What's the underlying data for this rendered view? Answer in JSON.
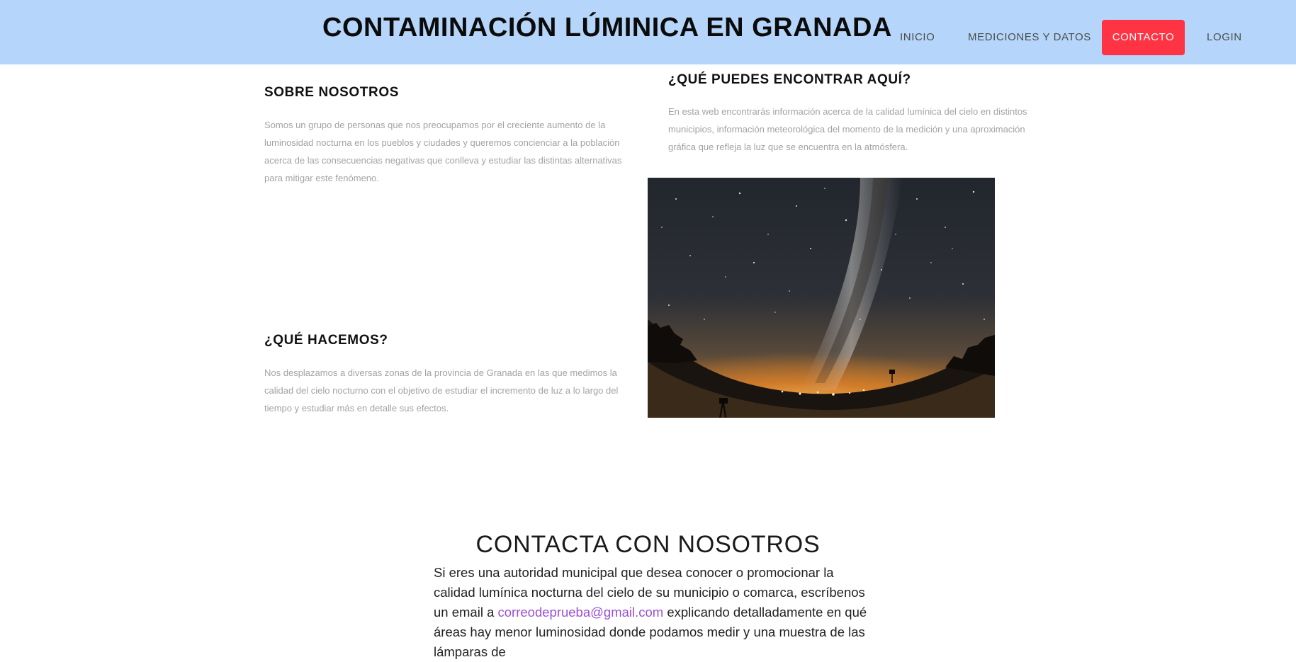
{
  "header": {
    "title": "CONTAMINACIÓN LÚMINICA EN GRANADA",
    "nav": {
      "inicio": "INICIO",
      "mediciones": "MEDICIONES Y DATOS",
      "contacto": "CONTACTO",
      "login": "LOGIN"
    },
    "colors": {
      "background": "#b5d6fa",
      "active": "#fe3343"
    }
  },
  "sections": {
    "sobre": {
      "title": "SOBRE NOSOTROS",
      "text": "Somos un grupo de personas que nos preocupamos por el creciente aumento de la luminosidad nocturna en los pueblos y ciudades y queremos concienciar a la población acerca de las consecuencias negativas que conlleva y estudiar las distintas alternativas para mitigar este fenómeno."
    },
    "que": {
      "title": "¿QUÉ PUEDES ENCONTRAR AQUÍ?",
      "text": "En esta web encontrarás información acerca de la calidad lumínica del cielo en distintos municipios, información meteorológica del momento de la medición y una aproximación gráfica que refleja la luz que se encuentra en la atmósfera."
    },
    "hacemos": {
      "title": "¿QUÉ HACEMOS?",
      "text": "Nos desplazamos a diversas zonas de la provincia de Granada en las que medimos la calidad del cielo nocturno con el objetivo de estudiar el incremento de luz a lo largo del tiempo y estudiar más en detalle sus efectos."
    }
  },
  "contact": {
    "title": "CONTACTA CON NOSOTROS",
    "text_before": "Si eres una autoridad municipal que desea conocer o promocionar la calidad lumínica nocturna del cielo de su municipio o comarca, escríbenos un email a ",
    "email": "correodeprueba@gmail.com",
    "text_after": " explicando detalladamente en qué áreas hay menor luminosidad donde podamos medir y una muestra de las lámparas de"
  }
}
